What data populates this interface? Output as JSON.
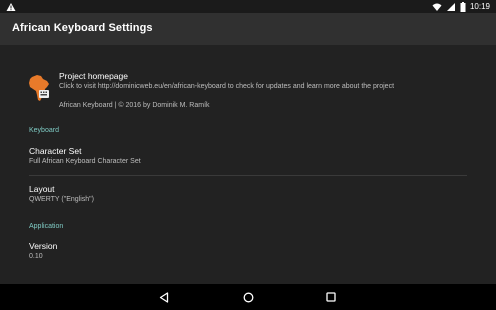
{
  "status_bar": {
    "time": "10:19",
    "notification_icon": "warning-triangle-icon",
    "icons": [
      "wifi-icon",
      "signal-icon",
      "battery-icon"
    ]
  },
  "app_bar": {
    "title": "African Keyboard Settings"
  },
  "homepage": {
    "icon": "africa-keyboard-logo",
    "title": "Project homepage",
    "summary": "Click to visit http://dominicweb.eu/en/african-keyboard to check for updates and learn more about the project",
    "copyright": "African Keyboard | © 2016 by Dominik M. Ramík"
  },
  "keyboard_section": {
    "header": "Keyboard",
    "character_set": {
      "title": "Character Set",
      "summary": "Full African Keyboard Character Set"
    },
    "layout": {
      "title": "Layout",
      "summary": "QWERTY (\"English\")"
    }
  },
  "application_section": {
    "header": "Application",
    "version": {
      "title": "Version",
      "summary": "0.10"
    }
  },
  "nav_bar": {
    "buttons": [
      "back-icon",
      "home-icon",
      "recents-icon"
    ]
  },
  "colors": {
    "accent": "#7fcbc4",
    "app_bar": "#303030",
    "background": "#222222",
    "logo_orange": "#e87a2a"
  }
}
